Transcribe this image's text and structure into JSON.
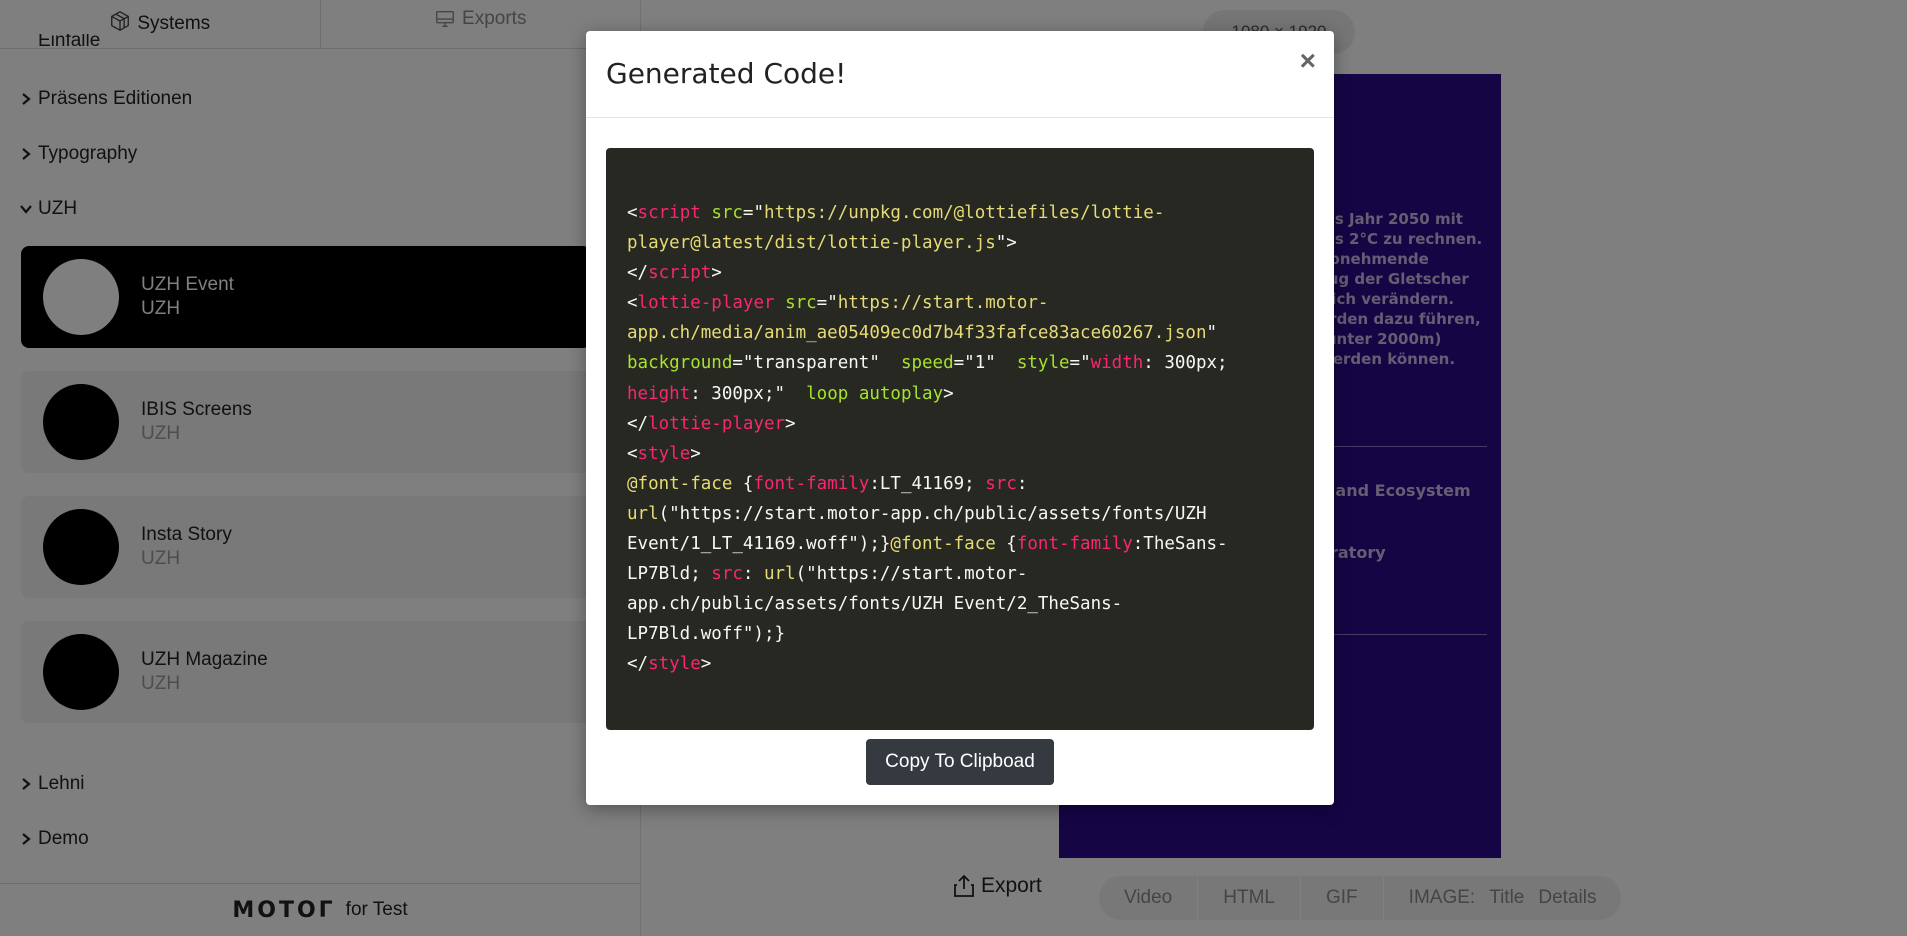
{
  "sidebar": {
    "tabs": [
      {
        "label": "Systems",
        "icon": "systems-cube-icon"
      },
      {
        "label": "Exports",
        "icon": "exports-monitor-icon"
      }
    ],
    "clipped_item": "Einfalle",
    "categories": {
      "presens": "Präsens Editionen",
      "typography": "Typography",
      "uzh": "UZH",
      "lehni": "Lehni",
      "demo": "Demo"
    },
    "cards": [
      {
        "title": "UZH Event",
        "subtitle": "UZH"
      },
      {
        "title": "IBIS Screens",
        "subtitle": "UZH"
      },
      {
        "title": "Insta Story",
        "subtitle": "UZH"
      },
      {
        "title": "UZH Magazine",
        "subtitle": "UZH"
      }
    ],
    "footer": {
      "brand": "MOTOΓ",
      "suffix": "for Test"
    }
  },
  "main": {
    "size_label": "1080 × 1920",
    "preview": {
      "text_block": "ins Jahr 2050 mit\nbis 2°C zu rechnen.\n abnehmende\nzug der Gletscher\ntlich verändern.\nerden dazu führen,\n(unter 2000m)\nwerden können.",
      "label_1": "e and Ecosystem",
      "label_2": "oratory",
      "background": "#2a0a8a"
    },
    "export_label": "Export",
    "formats": [
      "Video",
      "HTML",
      "GIF"
    ],
    "image_format": {
      "label": "IMAGE:",
      "options": [
        "Title",
        "Details"
      ]
    }
  },
  "modal": {
    "title": "Generated Code!",
    "close_label": "×",
    "code_lines": [
      [
        [
          "p",
          "<"
        ],
        [
          "t",
          "script"
        ],
        [
          "p",
          " "
        ],
        [
          "a",
          "src"
        ],
        [
          "p",
          "=\""
        ],
        [
          "s",
          "https://unpkg.com/@lottiefiles/lottie-"
        ]
      ],
      [
        [
          "s",
          "player@latest/dist/lottie-player.js"
        ],
        [
          "p",
          "\">"
        ]
      ],
      [
        [
          "p",
          "</"
        ],
        [
          "t",
          "script"
        ],
        [
          "p",
          ">"
        ]
      ],
      [
        [
          "p",
          "<"
        ],
        [
          "t",
          "lottie-player"
        ],
        [
          "p",
          " "
        ],
        [
          "a",
          "src"
        ],
        [
          "p",
          "=\""
        ],
        [
          "s",
          "https://start.motor-"
        ]
      ],
      [
        [
          "s",
          "app.ch/media/anim_ae05409ec0d7b4f33fafce83ace60267.json"
        ],
        [
          "p",
          "\""
        ]
      ],
      [
        [
          "a",
          "background"
        ],
        [
          "p",
          "=\"transparent\"  "
        ],
        [
          "a",
          "speed"
        ],
        [
          "p",
          "=\"1\"  "
        ],
        [
          "a",
          "style"
        ],
        [
          "p",
          "=\""
        ],
        [
          "t",
          "width"
        ],
        [
          "p",
          ": 300px;"
        ]
      ],
      [
        [
          "t",
          "height"
        ],
        [
          "p",
          ": 300px;\"  "
        ],
        [
          "a",
          "loop"
        ],
        [
          "p",
          " "
        ],
        [
          "a",
          "autoplay"
        ],
        [
          "p",
          ">"
        ]
      ],
      [
        [
          "p",
          "</"
        ],
        [
          "t",
          "lottie-player"
        ],
        [
          "p",
          ">"
        ]
      ],
      [
        [
          "p",
          "<"
        ],
        [
          "t",
          "style"
        ],
        [
          "p",
          ">"
        ]
      ],
      [
        [
          "s",
          "@font-face"
        ],
        [
          "p",
          " {"
        ],
        [
          "t",
          "font-family"
        ],
        [
          "p",
          ":LT_41169; "
        ],
        [
          "t",
          "src"
        ],
        [
          "p",
          ":"
        ]
      ],
      [
        [
          "s",
          "url"
        ],
        [
          "p",
          "(\"https://start.motor-app.ch/public/assets/fonts/UZH"
        ]
      ],
      [
        [
          "p",
          "Event/1_LT_41169.woff\");}"
        ],
        [
          "s",
          "@font-face"
        ],
        [
          "p",
          " {"
        ],
        [
          "t",
          "font-family"
        ],
        [
          "p",
          ":TheSans-"
        ]
      ],
      [
        [
          "p",
          "LP7Bld; "
        ],
        [
          "t",
          "src"
        ],
        [
          "p",
          ": "
        ],
        [
          "s",
          "url"
        ],
        [
          "p",
          "(\"https://start.motor-"
        ]
      ],
      [
        [
          "p",
          "app.ch/public/assets/fonts/UZH Event/2_TheSans-"
        ]
      ],
      [
        [
          "p",
          "LP7Bld.woff\");}"
        ]
      ],
      [
        [
          "p",
          "</"
        ],
        [
          "t",
          "style"
        ],
        [
          "p",
          ">"
        ]
      ]
    ],
    "code_colors": {
      "background": "#272822",
      "tag": "#f92672",
      "attr": "#a6e22e",
      "string": "#e6db74",
      "plain": "#f8f8f2"
    },
    "copy_label": "Copy To Clipboad"
  }
}
